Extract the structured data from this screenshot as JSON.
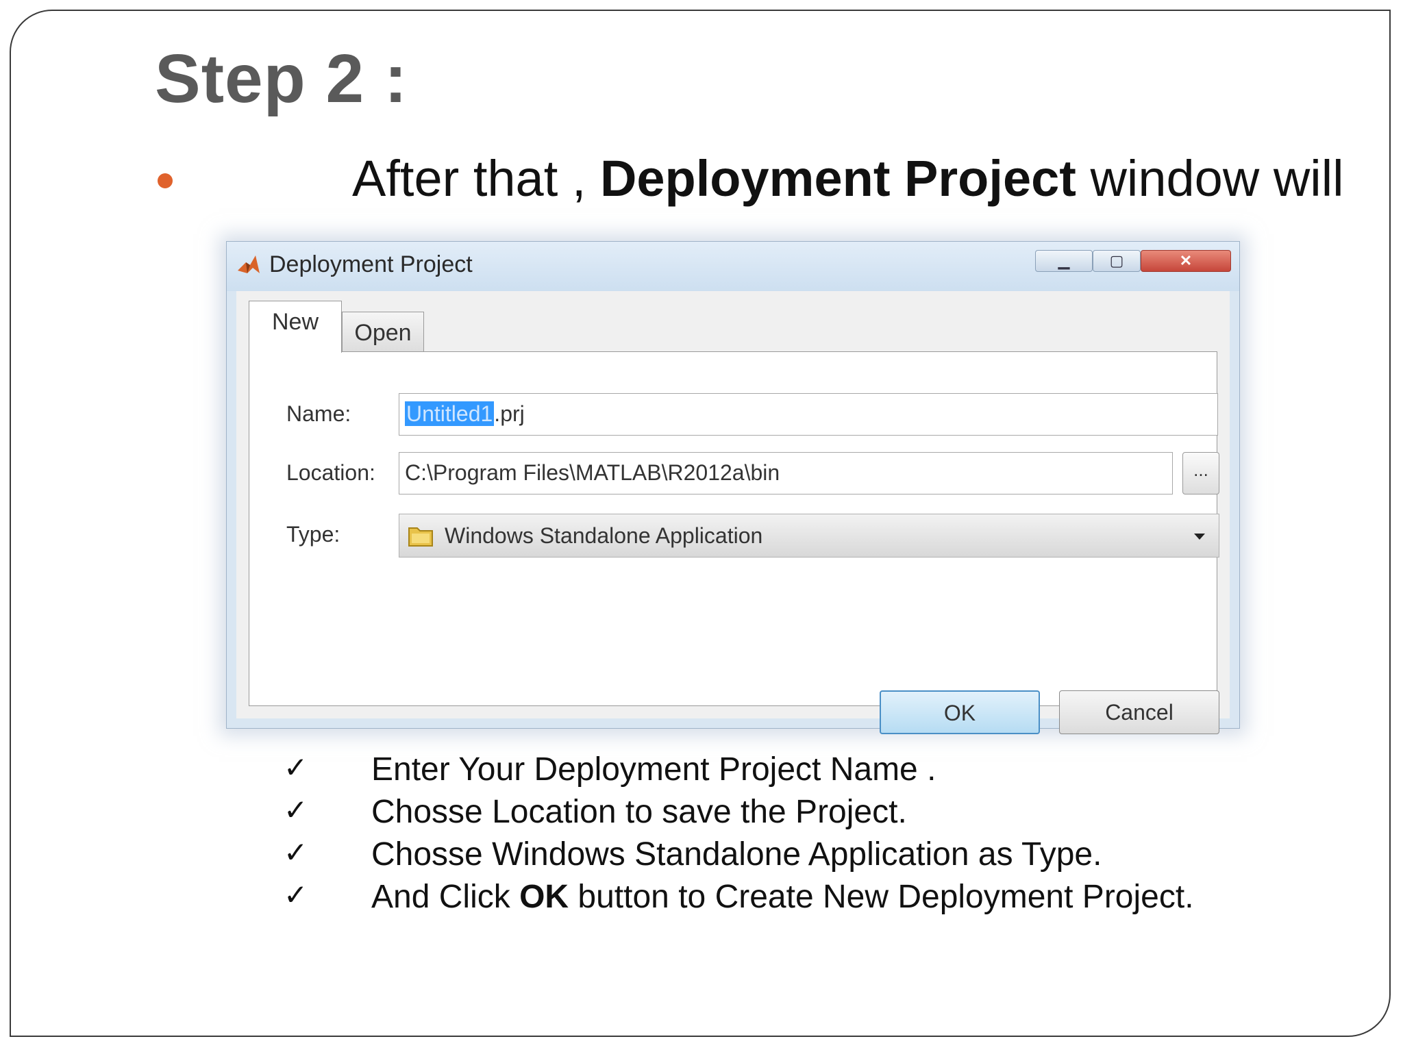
{
  "slide": {
    "title": "Step 2 :",
    "bullet": {
      "prefix": "After that , ",
      "bold": "Deployment Project",
      "suffix": " window will"
    }
  },
  "dialog": {
    "title": "Deployment Project",
    "tabs": [
      {
        "label": "New",
        "selected": true
      },
      {
        "label": "Open",
        "selected": false
      }
    ],
    "fields": {
      "name_label": "Name:",
      "name_selected": "Untitled1",
      "name_extension": ".prj",
      "location_label": "Location:",
      "location_value": "C:\\Program Files\\MATLAB\\R2012a\\bin",
      "browse_label": "...",
      "type_label": "Type:",
      "type_value": "Windows Standalone Application"
    },
    "buttons": {
      "ok": "OK",
      "cancel": "Cancel"
    }
  },
  "checklist": {
    "mark": "✓",
    "items": [
      "Enter Your Deployment Project Name .",
      "Chosse Location to save the Project.",
      "Chosse Windows Standalone Application as Type."
    ],
    "last_item": {
      "before": "And Click ",
      "bold": "OK",
      "after": " button to Create New Deployment Project."
    }
  },
  "colors": {
    "bullet": "#e0622c",
    "title": "#5a5a5a",
    "selection": "#3399ff"
  }
}
